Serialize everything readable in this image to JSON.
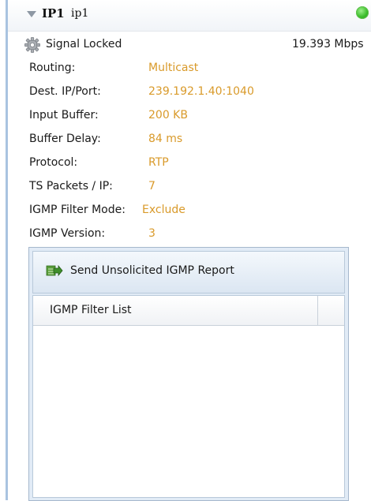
{
  "header": {
    "name": "IP1",
    "subname": "ip1",
    "status_color": "#3cbd2c"
  },
  "signal": {
    "icon": "gear-icon",
    "status": "Signal Locked",
    "rate": "19.393 Mbps"
  },
  "properties": [
    {
      "label": "Routing:",
      "value": "Multicast"
    },
    {
      "label": "Dest. IP/Port:",
      "value": "239.192.1.40:1040"
    },
    {
      "label": "Input Buffer:",
      "value": "200 KB"
    },
    {
      "label": "Buffer Delay:",
      "value": "84 ms"
    },
    {
      "label": "Protocol:",
      "value": "RTP"
    },
    {
      "label": "TS Packets / IP:",
      "value": "7"
    },
    {
      "label": "IGMP Filter Mode:",
      "value": "Exclude"
    },
    {
      "label": "IGMP Version:",
      "value": "3"
    }
  ],
  "igmp_panel": {
    "send_button_label": "Send Unsolicited IGMP Report",
    "send_button_icon": "send-report-icon",
    "filter_list_header": "IGMP Filter List"
  },
  "colors": {
    "value_text": "#d99a2a",
    "panel_border": "#a6b8cd",
    "accent_border": "#a9c3e0"
  }
}
